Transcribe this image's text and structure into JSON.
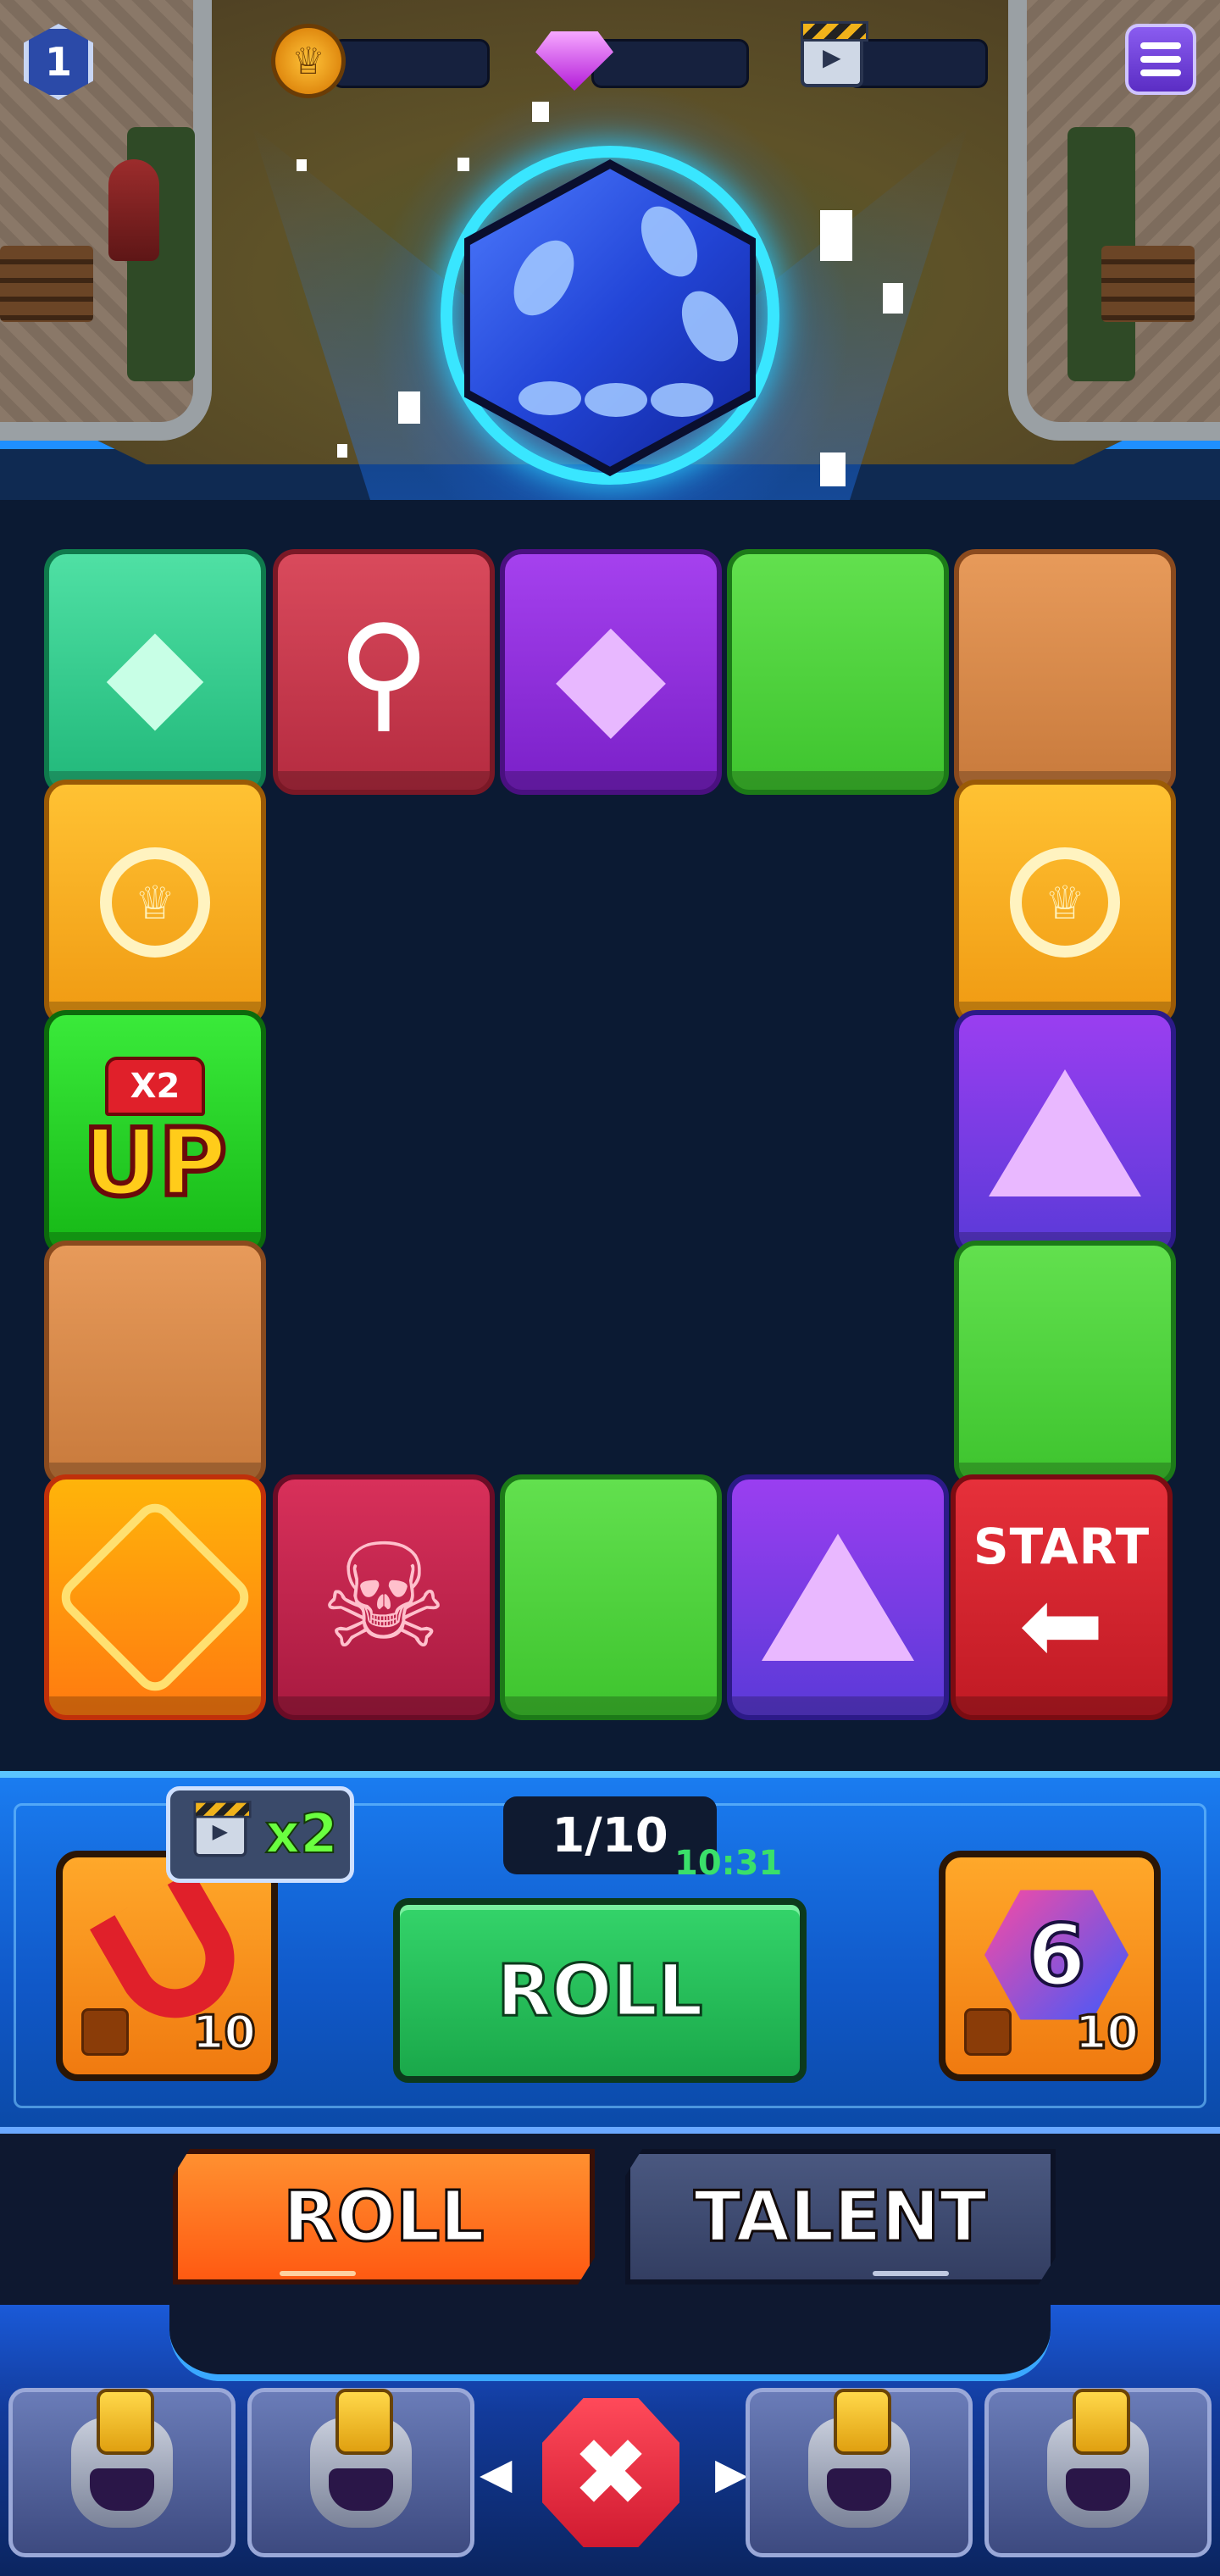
{
  "hud": {
    "level": "1",
    "currencies": [
      {
        "icon": "crown-coin-icon",
        "value": ""
      },
      {
        "icon": "gem-icon",
        "value": ""
      },
      {
        "icon": "video-clapper-icon",
        "value": ""
      }
    ],
    "menu_icon": "hamburger-menu-icon"
  },
  "dice_display": {
    "icon": "blue-dice-icon"
  },
  "board": {
    "tiles": [
      {
        "type": "emerald-reward",
        "icon": "emerald-gems-icon"
      },
      {
        "type": "keys",
        "icon": "keys-icon"
      },
      {
        "type": "gem-reward",
        "icon": "diamond-icon"
      },
      {
        "type": "grass",
        "icon": ""
      },
      {
        "type": "sand",
        "icon": ""
      },
      {
        "type": "coin-reward",
        "icon": "crown-coins-icon"
      },
      {
        "type": "coin-reward",
        "icon": "crown-coins-icon"
      },
      {
        "type": "double-up",
        "badge": "X2",
        "label": "UP"
      },
      {
        "type": "prism",
        "icon": "prism-icon"
      },
      {
        "type": "sand",
        "icon": ""
      },
      {
        "type": "grass",
        "icon": ""
      },
      {
        "type": "dice-reward",
        "icon": "dice-icon"
      },
      {
        "type": "skull",
        "icon": "skull-icon"
      },
      {
        "type": "grass",
        "icon": ""
      },
      {
        "type": "prism",
        "icon": "prism-icon"
      },
      {
        "type": "start",
        "label": "START",
        "icon": "arrow-left-icon"
      }
    ]
  },
  "controls": {
    "video_badge": {
      "label": "x2"
    },
    "roll_counter": "1/10",
    "timer": "10:31",
    "roll_button": "ROLL",
    "magnet_powerup": {
      "count": "10",
      "icon": "magnet-icon"
    },
    "six_powerup": {
      "value": "6",
      "count": "10",
      "icon": "six-dice-icon"
    }
  },
  "tabs": [
    {
      "label": "ROLL",
      "active": true
    },
    {
      "label": "TALENT",
      "active": false
    }
  ],
  "heroes": {
    "slots": [
      "hero-helmet-icon",
      "hero-helmet-icon",
      "hero-helmet-icon",
      "hero-helmet-icon"
    ],
    "close_icon": "close-icon"
  },
  "colors": {
    "accent_blue": "#1f8fff",
    "roll_green": "#34d46a",
    "tab_orange": "#ff7a20",
    "danger_red": "#e0202a"
  }
}
